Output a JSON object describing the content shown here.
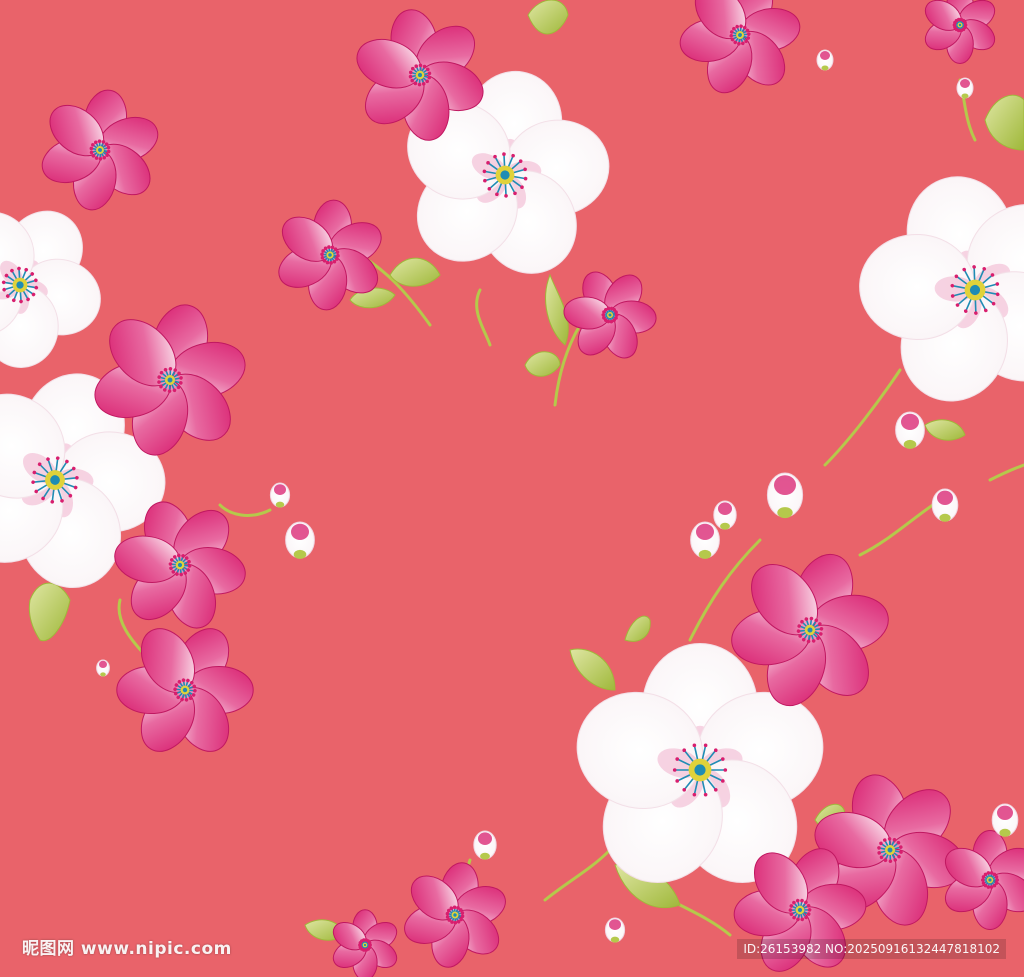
{
  "image": {
    "background_color": "#E9636A",
    "petal_white": "#FFFFFF",
    "petal_magenta": "#D81E6E",
    "center_teal": "#1F8CB4",
    "center_yellow": "#E0D23A",
    "stem_green": "#B5C94B"
  },
  "watermark": {
    "site_text": "昵图网 www.nipic.com",
    "id_text": "ID:26153982 NO:20250916132447818102"
  }
}
